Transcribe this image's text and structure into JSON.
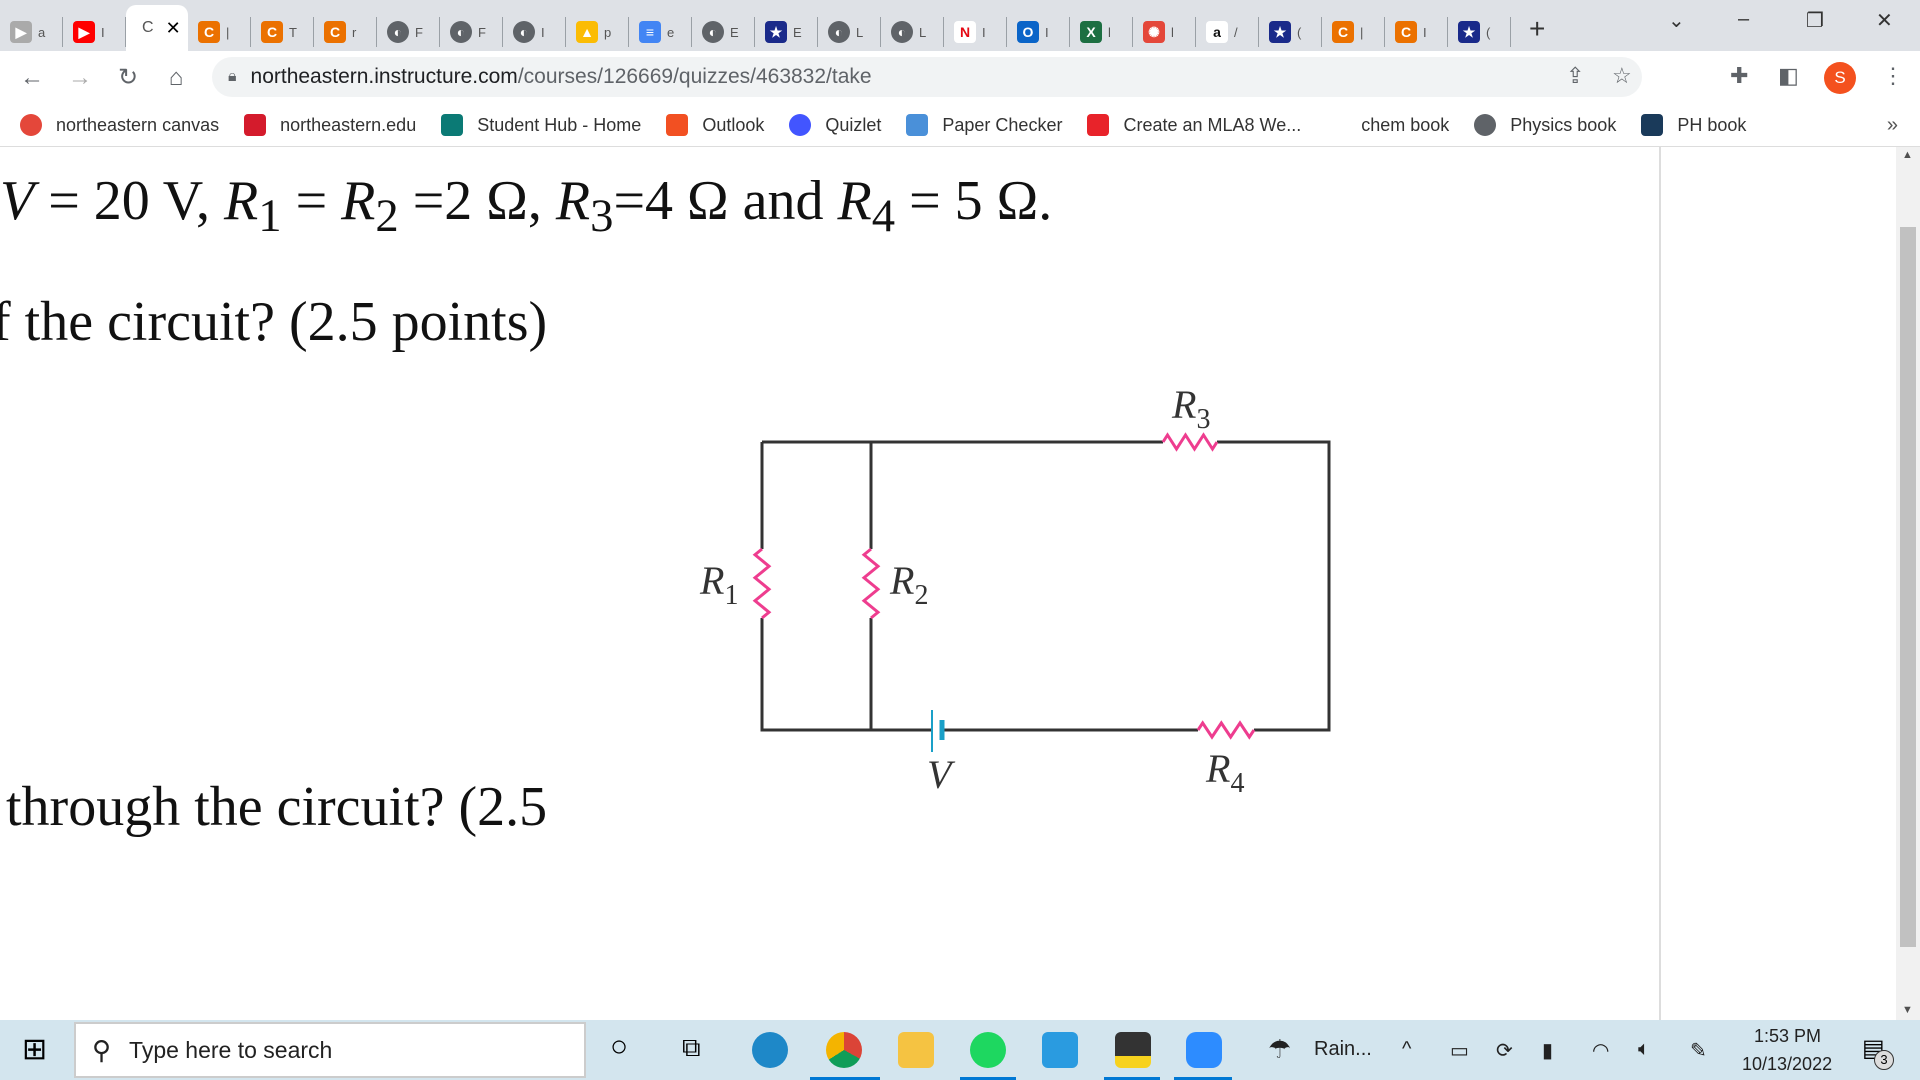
{
  "browser": {
    "tabs": [
      {
        "icon": "zoom-icon",
        "color": "#aaaaaa",
        "glyph": "▶",
        "label": "a"
      },
      {
        "icon": "youtube-icon",
        "color": "#ff0000",
        "glyph": "▶",
        "label": "I"
      },
      {
        "icon": "chegg-icon",
        "color": "#eb7100",
        "glyph": "C",
        "label": "|"
      },
      {
        "icon": "chegg-icon",
        "color": "#eb7100",
        "glyph": "C",
        "label": "T"
      },
      {
        "icon": "chegg-icon",
        "color": "#eb7100",
        "glyph": "C",
        "label": "r"
      },
      {
        "icon": "globe-icon",
        "color": "#5f6368",
        "glyph": "◐",
        "label": "F"
      },
      {
        "icon": "globe-icon",
        "color": "#5f6368",
        "glyph": "◐",
        "label": "F"
      },
      {
        "icon": "globe-icon",
        "color": "#5f6368",
        "glyph": "◐",
        "label": "I"
      },
      {
        "icon": "google-drive-icon",
        "color": "#fbbc04",
        "glyph": "▲",
        "label": "p"
      },
      {
        "icon": "google-docs-icon",
        "color": "#4285f4",
        "glyph": "≡",
        "label": "e"
      },
      {
        "icon": "globe-icon",
        "color": "#5f6368",
        "glyph": "◐",
        "label": "E"
      },
      {
        "icon": "shield-star-icon",
        "color": "#1a2a8a",
        "glyph": "★",
        "label": "E"
      },
      {
        "icon": "globe-icon",
        "color": "#5f6368",
        "glyph": "◐",
        "label": "L"
      },
      {
        "icon": "globe-icon",
        "color": "#5f6368",
        "glyph": "◐",
        "label": "L"
      },
      {
        "icon": "netflix-icon",
        "color": "#ffffff",
        "glyph": "N",
        "label": "I"
      },
      {
        "icon": "outlook-icon",
        "color": "#0a64c8",
        "glyph": "O",
        "label": "I"
      },
      {
        "icon": "excel-icon",
        "color": "#1d6f42",
        "glyph": "X",
        "label": "l"
      },
      {
        "icon": "canvas-icon",
        "color": "#e4473a",
        "glyph": "✺",
        "label": "l"
      },
      {
        "icon": "amazon-icon",
        "color": "#ffffff",
        "glyph": "a",
        "label": "/"
      },
      {
        "icon": "shield-star-icon",
        "color": "#1a2a8a",
        "glyph": "★",
        "label": "("
      },
      {
        "icon": "chegg-icon",
        "color": "#eb7100",
        "glyph": "C",
        "label": "|"
      },
      {
        "icon": "chegg-icon",
        "color": "#eb7100",
        "glyph": "C",
        "label": "I"
      },
      {
        "icon": "shield-star-icon",
        "color": "#1a2a8a",
        "glyph": "★",
        "label": "("
      }
    ],
    "active_tab": {
      "label": "C",
      "index_after": 1
    },
    "url_host": "northeastern.instructure.com",
    "url_path": "/courses/126669/quizzes/463832/take",
    "profile_initial": "S",
    "bookmarks": [
      {
        "label": "northeastern canvas",
        "icon": "canvas-icon",
        "color": "#e4473a"
      },
      {
        "label": "northeastern.edu",
        "icon": "northeastern-icon",
        "color": "#d41b2c"
      },
      {
        "label": "Student Hub - Home",
        "icon": "sharepoint-icon",
        "color": "#0b7a75"
      },
      {
        "label": "Outlook",
        "icon": "microsoft-icon",
        "color": "#f25022"
      },
      {
        "label": "Quizlet",
        "icon": "quizlet-icon",
        "color": "#4255ff"
      },
      {
        "label": "Paper Checker",
        "icon": "paper-checker-icon",
        "color": "#4a90d9"
      },
      {
        "label": "Create an MLA8 We...",
        "icon": "bookmark-red-icon",
        "color": "#e8232a"
      },
      {
        "label": "chem book",
        "icon": "",
        "color": ""
      },
      {
        "label": "Physics book",
        "icon": "globe-icon",
        "color": "#5f6368"
      },
      {
        "label": "PH book",
        "icon": "kindle-icon",
        "color": "#1a3a5a"
      }
    ],
    "bookmarks_more": "»"
  },
  "question": {
    "line1": {
      "v": "V",
      "eq1": " = 20 V, ",
      "r1": "R",
      "s1": "1",
      "eq2": " = ",
      "r2": "R",
      "s2": "2",
      "eq3": " =2 Ω, ",
      "r3": "R",
      "s3": "3",
      "eq4": "=4 Ω and ",
      "r4": "R",
      "s4": "4",
      "eq5": " = 5 Ω."
    },
    "line2": "f the circuit? (2.5 points)",
    "line3": "through the circuit? (2.5"
  },
  "circuit": {
    "labels": {
      "r1": "R",
      "r1s": "1",
      "r2": "R",
      "r2s": "2",
      "r3": "R",
      "r3s": "3",
      "r4": "R",
      "r4s": "4",
      "v": "V"
    },
    "colors": {
      "wire": "#333333",
      "resistor": "#ee3d8f",
      "battery": "#1aa0c8"
    }
  },
  "taskbar": {
    "search_placeholder": "Type here to search",
    "weather": "Rain...",
    "time": "1:53 PM",
    "date": "10/13/2022",
    "notifications": "3"
  }
}
